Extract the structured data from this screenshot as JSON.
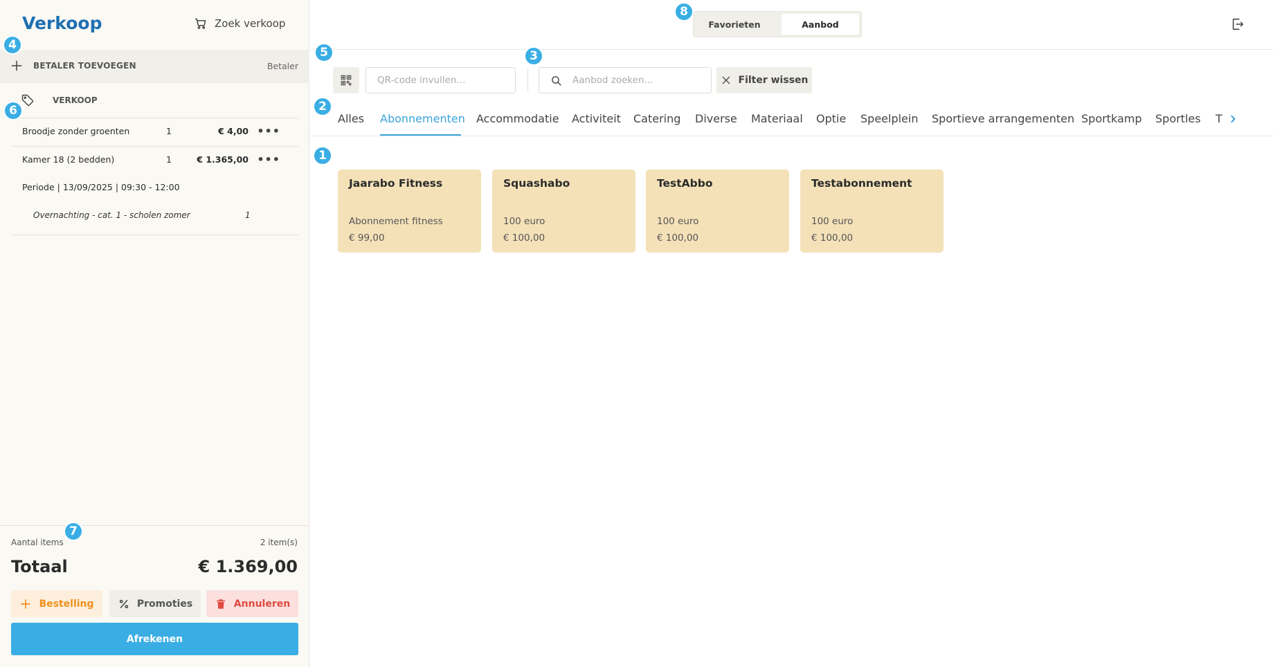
{
  "left": {
    "title": "Verkoop",
    "search_sale": "Zoek verkoop",
    "payer_add": "BETALER TOEVOEGEN",
    "payer_label": "Betaler",
    "sale_label": "VERKOOP",
    "items": [
      {
        "name": "Broodje zonder groenten",
        "qty": "1",
        "price": "€ 4,00"
      },
      {
        "name": "Kamer 18 (2 bedden)",
        "qty": "1",
        "price": "€ 1.365,00"
      }
    ],
    "periode": "Periode | 13/09/2025 | 09:30 - 12:00",
    "sub_item": {
      "name": "Overnachting - cat. 1 - scholen zomer",
      "qty": "1"
    },
    "count_label": "Aantal items",
    "count_value": "2 item(s)",
    "total_label": "Totaal",
    "total_value": "€ 1.369,00",
    "buttons": {
      "bestelling": "Bestelling",
      "promoties": "Promoties",
      "annuleren": "Annuleren",
      "afrekenen": "Afrekenen"
    }
  },
  "top": {
    "toggle": {
      "favorieten": "Favorieten",
      "aanbod": "Aanbod",
      "active": "Aanbod"
    }
  },
  "filters": {
    "qr_placeholder": "QR-code invullen...",
    "search_placeholder": "Aanbod zoeken...",
    "clear_label": "Filter wissen"
  },
  "tabs": [
    "Alles",
    "Abonnementen",
    "Accommodatie",
    "Activiteit",
    "Catering",
    "Diverse",
    "Materiaal",
    "Optie",
    "Speelplein",
    "Sportieve arrangementen",
    "Sportkamp",
    "Sportles",
    "T"
  ],
  "active_tab": "Abonnementen",
  "cards": [
    {
      "title": "Jaarabo Fitness",
      "desc": "Abonnement fitness",
      "price": "€ 99,00"
    },
    {
      "title": "Squashabo",
      "desc": "100 euro",
      "price": "€ 100,00"
    },
    {
      "title": "TestAbbo",
      "desc": "100 euro",
      "price": "€ 100,00"
    },
    {
      "title": "Testabonnement",
      "desc": "100 euro",
      "price": "€ 100,00"
    }
  ],
  "markers": [
    "1",
    "2",
    "3",
    "4",
    "5",
    "6",
    "7",
    "8"
  ],
  "colors": {
    "accent": "#3aaee4",
    "brand": "#1f6fb2",
    "card": "#f4e1b8",
    "warning": "#f0901e",
    "danger": "#e04b3f"
  }
}
